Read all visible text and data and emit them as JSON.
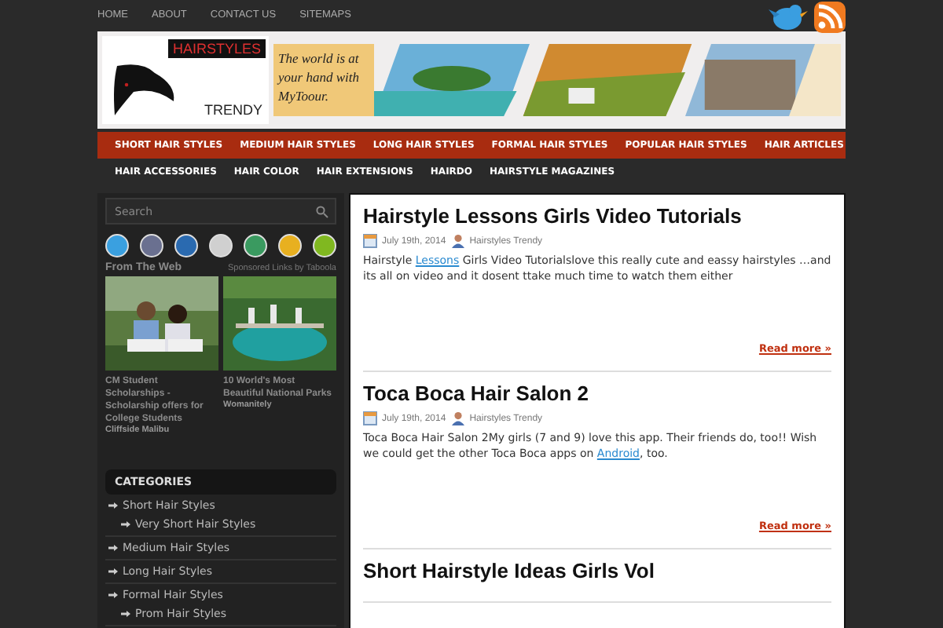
{
  "top_nav": [
    "HOME",
    "ABOUT",
    "CONTACT US",
    "SITEMAPS"
  ],
  "header": {
    "logo_title": "HAIRSTYLES",
    "logo_subtitle": "TRENDY",
    "ad_text": "The world is at your hand with MyToour."
  },
  "main_nav": [
    "SHORT HAIR STYLES",
    "MEDIUM HAIR STYLES",
    "LONG HAIR STYLES",
    "FORMAL HAIR STYLES",
    "POPULAR HAIR STYLES",
    "HAIR ARTICLES"
  ],
  "sub_nav": [
    "HAIR ACCESSORIES",
    "HAIR COLOR",
    "HAIR EXTENSIONS",
    "HAIRDO",
    "HAIRSTYLE MAGAZINES"
  ],
  "sidebar": {
    "search": {
      "placeholder": "Search"
    },
    "social_icons": [
      {
        "color": "#3aa0e0"
      },
      {
        "color": "#6a7090"
      },
      {
        "color": "#2a6ab0"
      },
      {
        "color": "#d0d0d0"
      },
      {
        "color": "#3a9a60"
      },
      {
        "color": "#e8b020"
      },
      {
        "color": "#80b820"
      }
    ],
    "from_web": {
      "title": "From The Web",
      "sponsor": "Sponsored Links by Taboola",
      "items": [
        {
          "title": "CM Student Scholarships - Scholarship offers for College Students",
          "source": "Cliffside Malibu"
        },
        {
          "title": "10 World's Most Beautiful National Parks",
          "source": "Womanitely"
        }
      ]
    },
    "categories": {
      "title": "CATEGORIES",
      "items": [
        {
          "label": "Short Hair Styles",
          "children": [
            {
              "label": "Very Short Hair Styles"
            }
          ]
        },
        {
          "label": "Medium Hair Styles"
        },
        {
          "label": "Long Hair Styles"
        },
        {
          "label": "Formal Hair Styles",
          "children": [
            {
              "label": "Prom Hair Styles"
            }
          ]
        }
      ]
    }
  },
  "posts": [
    {
      "title": "Hairstyle Lessons Girls Video Tutorials",
      "date": "July 19th, 2014",
      "author": "Hairstyles Trendy",
      "excerpt": [
        {
          "kind": "text",
          "text": "Hairstyle "
        },
        {
          "kind": "link",
          "text": "Lessons"
        },
        {
          "kind": "text",
          "text": " Girls Video Tutorialslove this really cute and eassy hairstyles …and its all on video and it dosent ttake much time to watch them either"
        }
      ],
      "read_more": "Read more »"
    },
    {
      "title": "Toca Boca Hair Salon 2",
      "date": "July 19th, 2014",
      "author": "Hairstyles Trendy",
      "excerpt": [
        {
          "kind": "text",
          "text": "Toca Boca Hair Salon 2My girls (7 and 9) love this app. Their friends do, too!! Wish we could get the other Toca Boca apps on "
        },
        {
          "kind": "link",
          "text": "Android"
        },
        {
          "kind": "text",
          "text": ", too."
        }
      ],
      "read_more": "Read more »"
    },
    {
      "title": "Short Hairstyle Ideas Girls Vol"
    }
  ]
}
